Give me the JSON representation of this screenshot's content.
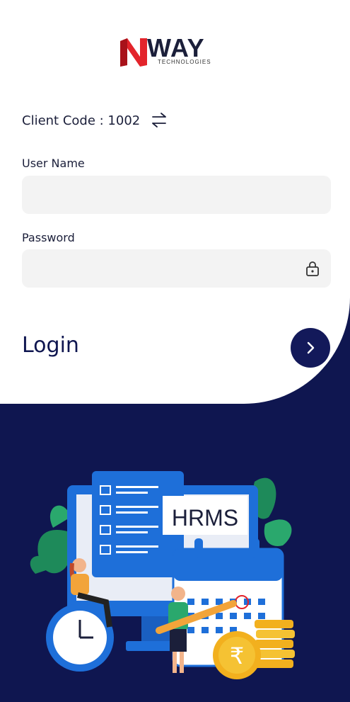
{
  "brand": {
    "logo_word": "WAY",
    "logo_sub": "TECHNOLOGIES",
    "logo_icon": "n-logo-icon"
  },
  "client": {
    "label": "Client Code : 1002",
    "switch_icon": "swap-arrows-icon"
  },
  "form": {
    "username_label": "User Name",
    "username_value": "",
    "username_placeholder": "",
    "password_label": "Password",
    "password_value": "",
    "password_placeholder": "",
    "password_icon": "lock-icon"
  },
  "login": {
    "label": "Login",
    "button_icon": "chevron-right-icon"
  },
  "illustration": {
    "screen_text": "HRMS",
    "currency_symbol": "₹"
  },
  "colors": {
    "navy": "#0f1650",
    "accent_blue": "#1e6fd9",
    "logo_red": "#e3242b",
    "field_bg": "#f3f3f3"
  }
}
